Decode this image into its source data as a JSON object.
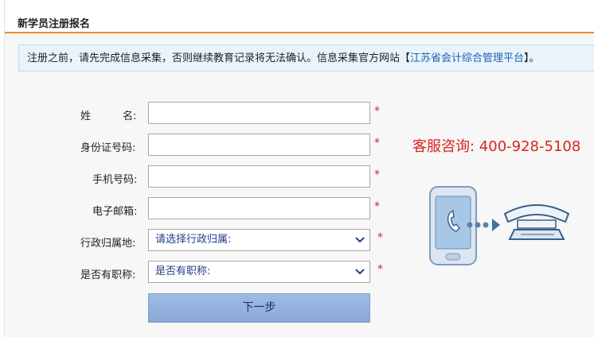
{
  "header": {
    "title": "新学员注册报名"
  },
  "notice": {
    "text": "注册之前，请先完成信息采集，否则继续教育记录将无法确认。信息采集官方网站",
    "link_open": "【",
    "link_text": "江苏省会计综合管理平台",
    "link_close": "】。"
  },
  "form": {
    "name_label_first": "姓",
    "name_label_last": "名:",
    "id_label": "身份证号码:",
    "phone_label": "手机号码:",
    "email_label": "电子邮箱:",
    "region_label": "行政归属地:",
    "region_value": "请选择行政归属:",
    "title_label": "是否有职称:",
    "title_value": "是否有职称:",
    "required_mark": "*",
    "submit_label": "下一步"
  },
  "support": {
    "hotline": "客服咨询: 400-928-5108"
  },
  "icons": [
    "phone-call-icon",
    "arrow-icon",
    "telephone-handset-icon",
    "chevron-down-icon"
  ],
  "colors": {
    "accent": "#f08a24",
    "required": "#e02020",
    "hotline": "#d7261e",
    "link": "#1b5fb6",
    "button": "#8aa9d8"
  }
}
